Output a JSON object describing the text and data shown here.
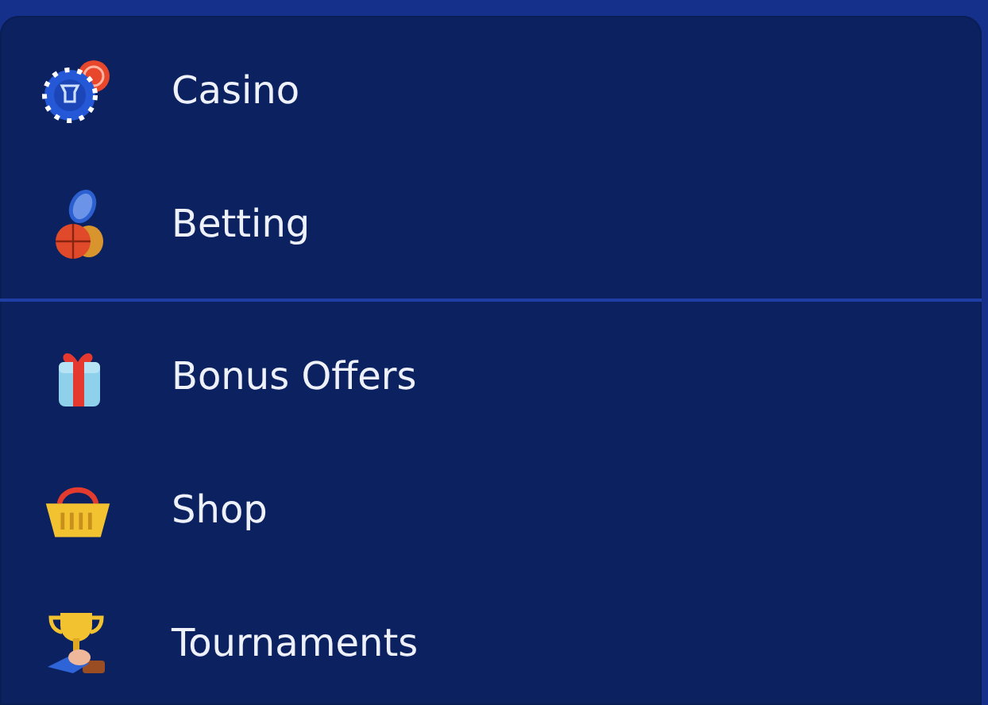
{
  "menu": {
    "sections": [
      {
        "items": [
          {
            "label": "Casino",
            "kind": "chips"
          },
          {
            "label": "Betting",
            "kind": "sports"
          }
        ]
      },
      {
        "items": [
          {
            "label": "Bonus Offers",
            "kind": "gift"
          },
          {
            "label": "Shop",
            "kind": "basket"
          },
          {
            "label": "Tournaments",
            "kind": "trophy"
          }
        ]
      }
    ]
  }
}
